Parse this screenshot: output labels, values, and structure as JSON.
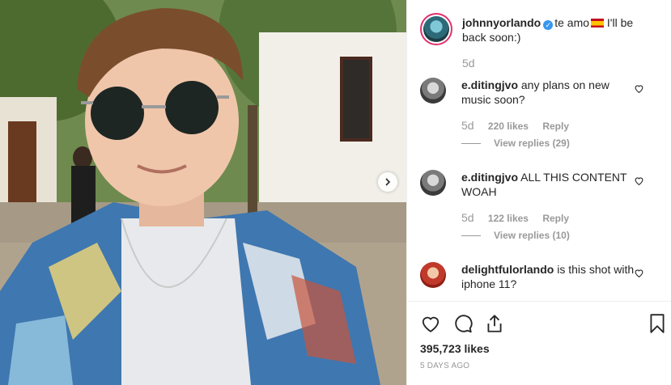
{
  "post": {
    "photo_alt": "",
    "next_icon": "chevron-right-icon"
  },
  "caption": {
    "username": "johnnyorlando",
    "text_before_flag": "te amo",
    "text_after_flag": " I'll be back soon:)",
    "time": "5d"
  },
  "comments": [
    {
      "username": "e.ditingjvo",
      "text": "any plans on new music soon?",
      "time": "5d",
      "likes": "220 likes",
      "reply": "Reply",
      "view_replies": "View replies (29)"
    },
    {
      "username": "e.ditingjvo",
      "text": "ALL THIS CONTENT WOAH",
      "time": "5d",
      "likes": "122 likes",
      "reply": "Reply",
      "view_replies": "View replies (10)"
    },
    {
      "username": "delightfulorlando",
      "text": "is this shot with iphone 11?"
    }
  ],
  "actions": {
    "likes_count": "395,723 likes",
    "timestamp": "5 DAYS AGO"
  },
  "colors": {
    "text": "#262626",
    "muted": "#999999",
    "verified": "#3897f0",
    "border": "#efefef"
  }
}
